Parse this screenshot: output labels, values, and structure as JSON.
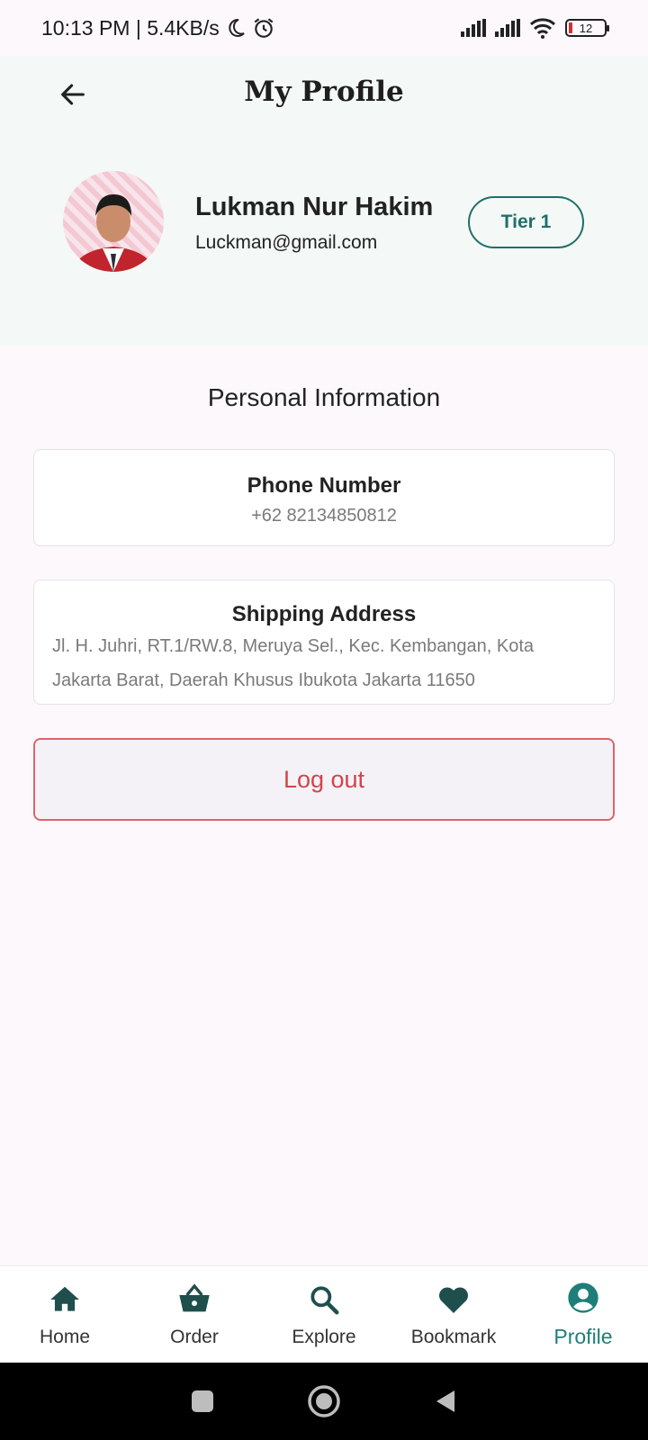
{
  "status_bar": {
    "time_speed": "10:13 PM | 5.4KB/s",
    "battery": "12"
  },
  "header": {
    "title": "My Profile"
  },
  "profile": {
    "name": "Lukman Nur Hakim",
    "email": "Luckman@gmail.com",
    "tier": "Tier 1"
  },
  "personal_info": {
    "section_title": "Personal Information",
    "phone_label": "Phone Number",
    "phone_value": "+62 82134850812",
    "address_label": "Shipping Address",
    "address_value": "Jl. H. Juhri, RT.1/RW.8, Meruya Sel., Kec. Kembangan, Kota Jakarta Barat, Daerah Khusus Ibukota Jakarta 11650"
  },
  "logout_label": "Log out",
  "bottom_nav": {
    "items": [
      {
        "label": "Home",
        "icon": "home-icon"
      },
      {
        "label": "Order",
        "icon": "basket-icon"
      },
      {
        "label": "Explore",
        "icon": "search-icon"
      },
      {
        "label": "Bookmark",
        "icon": "heart-icon"
      },
      {
        "label": "Profile",
        "icon": "account-icon"
      }
    ],
    "active": "Profile"
  },
  "colors": {
    "accent": "#1f7f78",
    "nav_icon": "#1f4f4c",
    "logout": "#d0454b",
    "header_bg": "#f4f8f6",
    "page_bg": "#fdf8fc"
  }
}
